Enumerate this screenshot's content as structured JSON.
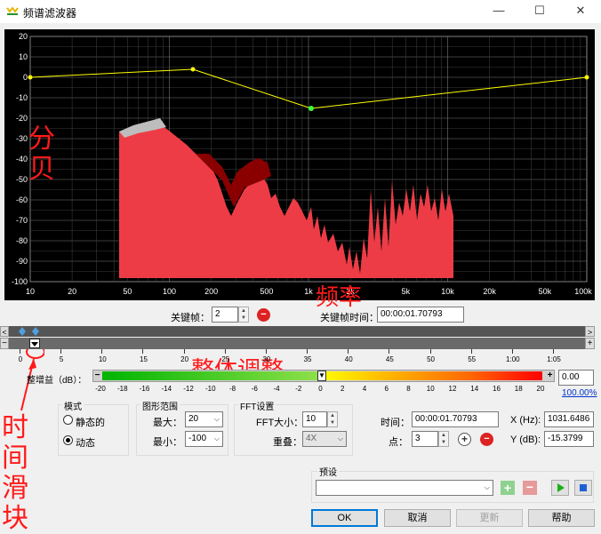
{
  "window": {
    "title": "频谱滤波器",
    "minimize": "—",
    "maximize": "☐",
    "close": "✕"
  },
  "graph": {
    "y_ticks": [
      "20",
      "10",
      "0",
      "-10",
      "-20",
      "-30",
      "-40",
      "-50",
      "-60",
      "-70",
      "-80",
      "-90",
      "-100"
    ],
    "x_ticks": [
      "10",
      "20",
      "50",
      "100",
      "200",
      "500",
      "1k",
      "2k",
      "5k",
      "10k",
      "20k",
      "50k",
      "100k"
    ]
  },
  "keyframe": {
    "label": "关键帧：",
    "value": "2",
    "time_label": "关键帧时间：",
    "time_value": "00:00:01.70793"
  },
  "timeline": {
    "ticks": [
      "0",
      "5",
      "10",
      "15",
      "20",
      "25",
      "30",
      "35",
      "40",
      "45",
      "50",
      "55",
      "1:00",
      "1:05"
    ]
  },
  "gain": {
    "label": "整增益（dB）：",
    "scale": [
      "-20",
      "-18",
      "-16",
      "-14",
      "-12",
      "-10",
      "-8",
      "-6",
      "-4",
      "-2",
      "0",
      "2",
      "4",
      "6",
      "8",
      "10",
      "12",
      "14",
      "16",
      "18",
      "20"
    ],
    "value": "0.00",
    "percent": "100.00%"
  },
  "mode": {
    "title": "模式",
    "static": "静态的",
    "dynamic": "动态",
    "selected": "dynamic"
  },
  "range": {
    "title": "图形范围",
    "max_label": "最大：",
    "max": "20",
    "min_label": "最小：",
    "min": "-100"
  },
  "fft": {
    "title": "FFT设置",
    "size_label": "FFT大小：",
    "size": "10",
    "overlap_label": "重叠：",
    "overlap": "4X"
  },
  "point": {
    "time_label": "时间：",
    "time": "00:00:01.70793",
    "point_label": "点：",
    "point": "3",
    "x_label": "X (Hz):",
    "x": "1031.6486",
    "y_label": "Y (dB):",
    "y": "-15.3799"
  },
  "preset": {
    "title": "预设",
    "value": ""
  },
  "buttons": {
    "ok": "OK",
    "cancel": "取消",
    "update": "更新",
    "help": "帮助"
  },
  "annotations": {
    "db": "分贝",
    "freq": "频率",
    "overall": "整体调整",
    "time_slider": "时间滑块"
  },
  "colors": {
    "curve": "#ffff00",
    "spectrum_fill": "#ee3c46",
    "spectrum_dark": "#8a0000",
    "annotation": "#ff1a1a"
  }
}
